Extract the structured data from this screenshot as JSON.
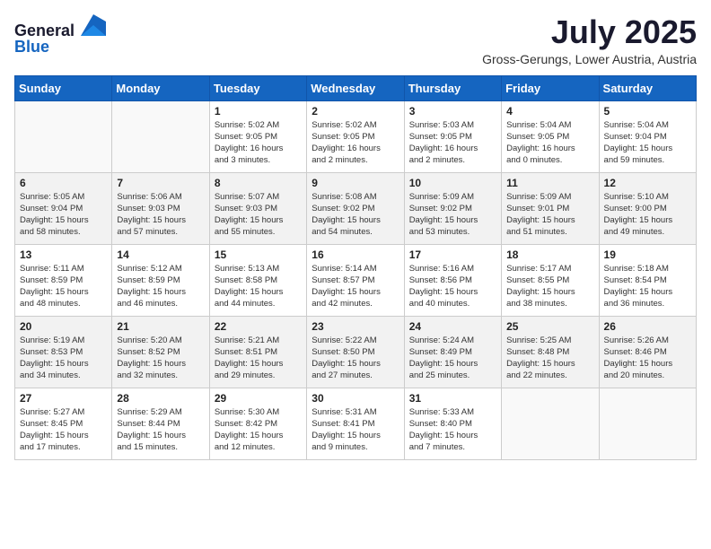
{
  "header": {
    "logo_line1": "General",
    "logo_line2": "Blue",
    "month_title": "July 2025",
    "location": "Gross-Gerungs, Lower Austria, Austria"
  },
  "weekdays": [
    "Sunday",
    "Monday",
    "Tuesday",
    "Wednesday",
    "Thursday",
    "Friday",
    "Saturday"
  ],
  "weeks": [
    [
      {
        "day": "",
        "info": ""
      },
      {
        "day": "",
        "info": ""
      },
      {
        "day": "1",
        "info": "Sunrise: 5:02 AM\nSunset: 9:05 PM\nDaylight: 16 hours\nand 3 minutes."
      },
      {
        "day": "2",
        "info": "Sunrise: 5:02 AM\nSunset: 9:05 PM\nDaylight: 16 hours\nand 2 minutes."
      },
      {
        "day": "3",
        "info": "Sunrise: 5:03 AM\nSunset: 9:05 PM\nDaylight: 16 hours\nand 2 minutes."
      },
      {
        "day": "4",
        "info": "Sunrise: 5:04 AM\nSunset: 9:05 PM\nDaylight: 16 hours\nand 0 minutes."
      },
      {
        "day": "5",
        "info": "Sunrise: 5:04 AM\nSunset: 9:04 PM\nDaylight: 15 hours\nand 59 minutes."
      }
    ],
    [
      {
        "day": "6",
        "info": "Sunrise: 5:05 AM\nSunset: 9:04 PM\nDaylight: 15 hours\nand 58 minutes."
      },
      {
        "day": "7",
        "info": "Sunrise: 5:06 AM\nSunset: 9:03 PM\nDaylight: 15 hours\nand 57 minutes."
      },
      {
        "day": "8",
        "info": "Sunrise: 5:07 AM\nSunset: 9:03 PM\nDaylight: 15 hours\nand 55 minutes."
      },
      {
        "day": "9",
        "info": "Sunrise: 5:08 AM\nSunset: 9:02 PM\nDaylight: 15 hours\nand 54 minutes."
      },
      {
        "day": "10",
        "info": "Sunrise: 5:09 AM\nSunset: 9:02 PM\nDaylight: 15 hours\nand 53 minutes."
      },
      {
        "day": "11",
        "info": "Sunrise: 5:09 AM\nSunset: 9:01 PM\nDaylight: 15 hours\nand 51 minutes."
      },
      {
        "day": "12",
        "info": "Sunrise: 5:10 AM\nSunset: 9:00 PM\nDaylight: 15 hours\nand 49 minutes."
      }
    ],
    [
      {
        "day": "13",
        "info": "Sunrise: 5:11 AM\nSunset: 8:59 PM\nDaylight: 15 hours\nand 48 minutes."
      },
      {
        "day": "14",
        "info": "Sunrise: 5:12 AM\nSunset: 8:59 PM\nDaylight: 15 hours\nand 46 minutes."
      },
      {
        "day": "15",
        "info": "Sunrise: 5:13 AM\nSunset: 8:58 PM\nDaylight: 15 hours\nand 44 minutes."
      },
      {
        "day": "16",
        "info": "Sunrise: 5:14 AM\nSunset: 8:57 PM\nDaylight: 15 hours\nand 42 minutes."
      },
      {
        "day": "17",
        "info": "Sunrise: 5:16 AM\nSunset: 8:56 PM\nDaylight: 15 hours\nand 40 minutes."
      },
      {
        "day": "18",
        "info": "Sunrise: 5:17 AM\nSunset: 8:55 PM\nDaylight: 15 hours\nand 38 minutes."
      },
      {
        "day": "19",
        "info": "Sunrise: 5:18 AM\nSunset: 8:54 PM\nDaylight: 15 hours\nand 36 minutes."
      }
    ],
    [
      {
        "day": "20",
        "info": "Sunrise: 5:19 AM\nSunset: 8:53 PM\nDaylight: 15 hours\nand 34 minutes."
      },
      {
        "day": "21",
        "info": "Sunrise: 5:20 AM\nSunset: 8:52 PM\nDaylight: 15 hours\nand 32 minutes."
      },
      {
        "day": "22",
        "info": "Sunrise: 5:21 AM\nSunset: 8:51 PM\nDaylight: 15 hours\nand 29 minutes."
      },
      {
        "day": "23",
        "info": "Sunrise: 5:22 AM\nSunset: 8:50 PM\nDaylight: 15 hours\nand 27 minutes."
      },
      {
        "day": "24",
        "info": "Sunrise: 5:24 AM\nSunset: 8:49 PM\nDaylight: 15 hours\nand 25 minutes."
      },
      {
        "day": "25",
        "info": "Sunrise: 5:25 AM\nSunset: 8:48 PM\nDaylight: 15 hours\nand 22 minutes."
      },
      {
        "day": "26",
        "info": "Sunrise: 5:26 AM\nSunset: 8:46 PM\nDaylight: 15 hours\nand 20 minutes."
      }
    ],
    [
      {
        "day": "27",
        "info": "Sunrise: 5:27 AM\nSunset: 8:45 PM\nDaylight: 15 hours\nand 17 minutes."
      },
      {
        "day": "28",
        "info": "Sunrise: 5:29 AM\nSunset: 8:44 PM\nDaylight: 15 hours\nand 15 minutes."
      },
      {
        "day": "29",
        "info": "Sunrise: 5:30 AM\nSunset: 8:42 PM\nDaylight: 15 hours\nand 12 minutes."
      },
      {
        "day": "30",
        "info": "Sunrise: 5:31 AM\nSunset: 8:41 PM\nDaylight: 15 hours\nand 9 minutes."
      },
      {
        "day": "31",
        "info": "Sunrise: 5:33 AM\nSunset: 8:40 PM\nDaylight: 15 hours\nand 7 minutes."
      },
      {
        "day": "",
        "info": ""
      },
      {
        "day": "",
        "info": ""
      }
    ]
  ]
}
